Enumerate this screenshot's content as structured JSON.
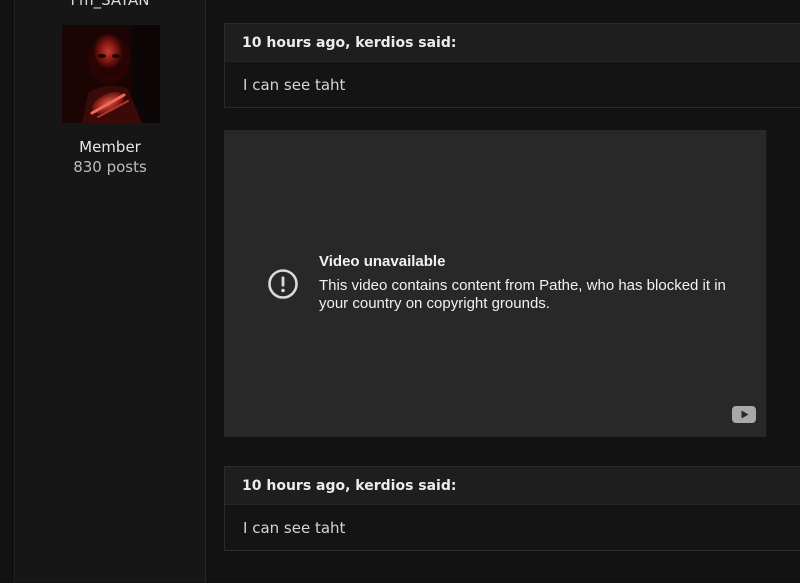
{
  "author": {
    "username": "I'm_SATAN",
    "rank": "Member",
    "post_count": "830 posts"
  },
  "quotes": [
    {
      "header": "10 hours ago, kerdios said:",
      "text": "I can see taht"
    },
    {
      "header": "10 hours ago, kerdios said:",
      "text": "I can see taht"
    }
  ],
  "video": {
    "title": "Video unavailable",
    "message": "This video contains content from Pathe, who has blocked it in your country on copyright grounds.",
    "icon": "alert-circle-icon",
    "logo": "youtube-logo-icon"
  }
}
